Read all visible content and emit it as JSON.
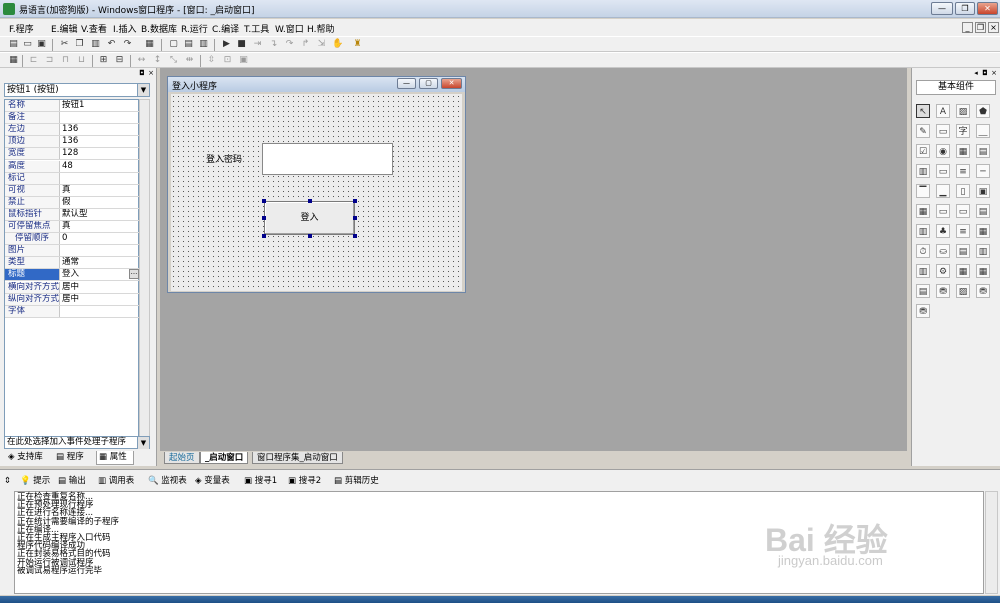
{
  "window": {
    "title": "易语言(加密狗版) - Windows窗口程序 - [窗口: _启动窗口]",
    "controls": {
      "minimize": "—",
      "restore": "❐",
      "close": "✕"
    }
  },
  "menu": {
    "items": [
      "F.程序",
      "E.编辑",
      "V.查看",
      "I.插入",
      "B.数据库",
      "R.运行",
      "C.编译",
      "T.工具",
      "W.窗口",
      "H.帮助"
    ],
    "mdi_controls": [
      "_",
      "❐",
      "×"
    ]
  },
  "left_panel": {
    "object_select": "按钮1 (按钮)",
    "properties": [
      {
        "name": "名称",
        "value": "按钮1"
      },
      {
        "name": "备注",
        "value": ""
      },
      {
        "name": "左边",
        "value": "136"
      },
      {
        "name": "顶边",
        "value": "136"
      },
      {
        "name": "宽度",
        "value": "128"
      },
      {
        "name": "高度",
        "value": "48"
      },
      {
        "name": "标记",
        "value": ""
      },
      {
        "name": "可视",
        "value": "真"
      },
      {
        "name": "禁止",
        "value": "假"
      },
      {
        "name": "鼠标指针",
        "value": "默认型"
      },
      {
        "name": "可停留焦点",
        "value": "真"
      },
      {
        "name": "停留顺序",
        "value": "0"
      },
      {
        "name": "图片",
        "value": ""
      },
      {
        "name": "类型",
        "value": "通常"
      },
      {
        "name": "标题",
        "value": "登入"
      },
      {
        "name": "横向对齐方式",
        "value": "居中"
      },
      {
        "name": "纵向对齐方式",
        "value": "居中"
      },
      {
        "name": "字体",
        "value": ""
      }
    ],
    "event_select": "在此处选择加入事件处理子程序",
    "tabs": [
      "支持库",
      "程序",
      "属性"
    ]
  },
  "form": {
    "title": "登入小程序",
    "password_label": "登入密码",
    "login_button": "登入"
  },
  "doc_tabs": [
    "起始页",
    "_启动窗口",
    "窗口程序集_启动窗口"
  ],
  "palette": {
    "title": "基本组件"
  },
  "output": {
    "tabs": [
      "提示",
      "输出",
      "调用表",
      "监视表",
      "变量表",
      "搜寻1",
      "搜寻2",
      "剪辑历史"
    ],
    "lines": [
      "正在检查重复名称...",
      "正在预处理现行程序",
      "正在进行名称连接...",
      "正在统计需要编译的子程序",
      "正在编译...",
      "正在生成主程序入口代码",
      "程序代码编译成功",
      "正在封装易格式目的代码",
      "开始运行被调试程序",
      "被调试易程序运行完毕"
    ]
  },
  "watermark": {
    "brand": "Bai 经验",
    "url": "jingyan.baidu.com"
  }
}
